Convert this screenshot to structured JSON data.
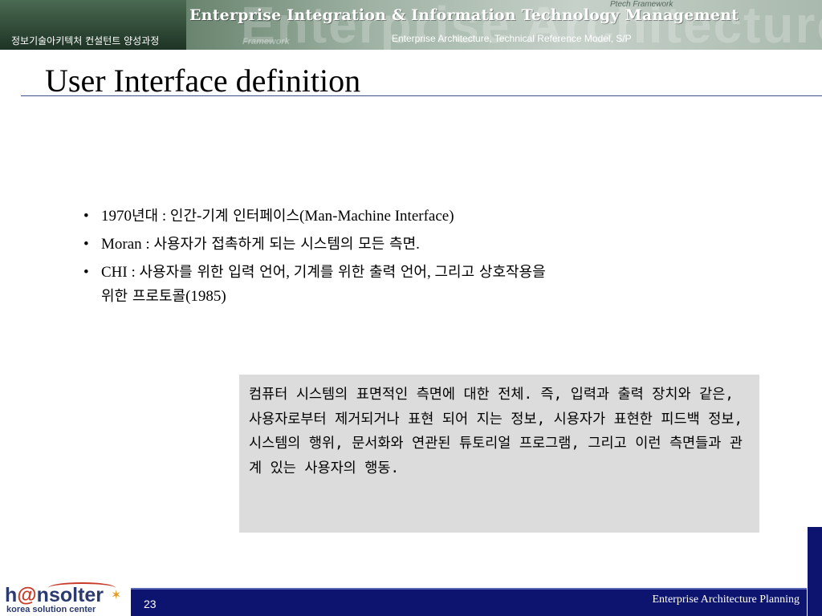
{
  "header": {
    "title": "Enterprise Integration & Information Technology Management",
    "course": "정보기술아키텍처 컨설턴트 양성과정",
    "subtitle": "Enterprise Architecture, Technical Reference Model, S/P",
    "watermark": "Enterprise Architecture Model",
    "watermark_small": "Framework",
    "watermark_ptech": "Ptech Framework"
  },
  "slide": {
    "title": "User Interface definition",
    "bullets": [
      {
        "lead": "1970",
        "korean": "년대",
        "rest_a": " : ",
        "korean2": "인간",
        "rest_b": "-",
        "korean3": "기계 인터페이스",
        "rest_c": "(Man-Machine Interface)"
      },
      {
        "lead": "Moran : ",
        "korean": "사용자가 접촉하게 되는 시스템의 모든 측면",
        "rest_a": "."
      },
      {
        "lead": "CHI : ",
        "korean": "사용자를 위한 입력 언어",
        "rest_a": ", ",
        "korean2": "기계를 위한 출력 언어",
        "rest_b": ", ",
        "korean3": "그리고 상호작용을",
        "line2_korean": "위한 프로토콜",
        "line2_rest": "(1985)"
      }
    ],
    "callout": "컴퓨터 시스템의 표면적인 측면에 대한 전체. 즉, 입력과 출력 장치와  같은, 사용자로부터 제거되거나 표현 되어 지는 정보, 시용자가 표현한 피드백 정보, 시스템의 행위, 문서화와 연관된 튜토리얼 프로그램, 그리고 이런 측면들과 관계 있는 사용자의 행동."
  },
  "footer": {
    "logo_prefix": "h",
    "logo_at": "@",
    "logo_suffix": "nsolter",
    "logo_tagline": "korea solution center",
    "page_number": "23",
    "course_name": "Enterprise Architecture Planning"
  },
  "colors": {
    "footer_bar": "#0c1470",
    "title_rule": "#3e4f8c",
    "callout_bg": "#dcdcdc"
  }
}
